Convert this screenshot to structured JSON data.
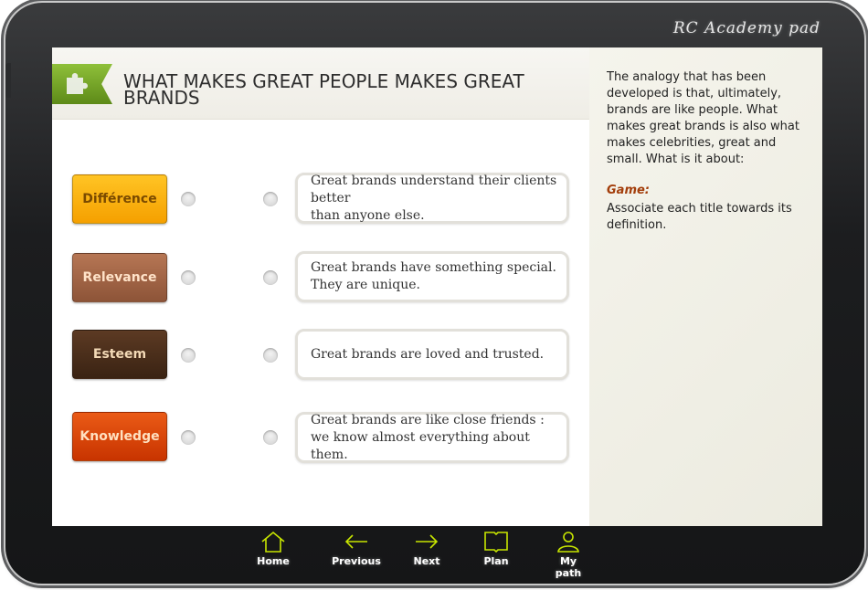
{
  "device": {
    "brand": "RC Academy pad"
  },
  "lesson": {
    "title": "WHAT MAKES GREAT PEOPLE MAKES GREAT BRANDS"
  },
  "terms": [
    {
      "label": "Différence"
    },
    {
      "label": "Relevance"
    },
    {
      "label": "Esteem"
    },
    {
      "label": "Knowledge"
    }
  ],
  "definitions": [
    {
      "text": "Great brands understand their clients better\nthan anyone else."
    },
    {
      "text": "Great brands have something special.\nThey are unique."
    },
    {
      "text": "Great brands are loved and trusted."
    },
    {
      "text": "Great brands are like close friends :\nwe know almost everything about them."
    }
  ],
  "sidebar": {
    "intro": "The analogy that has been developed is that, ultimately, brands are like people. What makes great brands is also what makes celebrities, great and small. What is it about:",
    "game_label": "Game:",
    "game_text": "Associate each title towards its definition."
  },
  "nav": {
    "home": "Home",
    "previous": "Previous",
    "next": "Next",
    "plan": "Plan",
    "my_path": "My path"
  },
  "colors": {
    "accent_green": "#7fb02e",
    "nav_icon": "#c8e600",
    "game_label": "#a33e0b"
  }
}
